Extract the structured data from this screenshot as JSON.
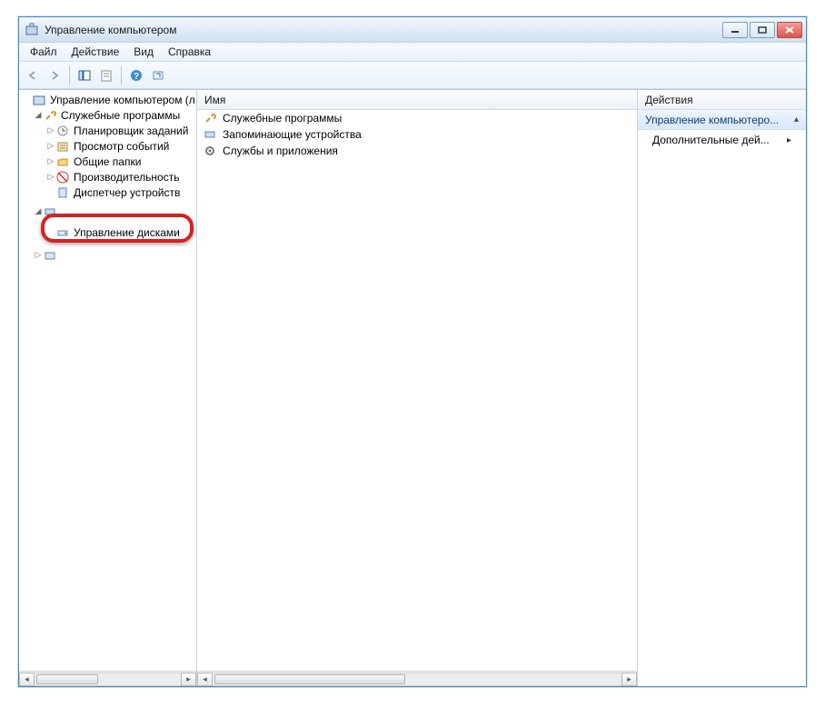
{
  "window": {
    "title": "Управление компьютером"
  },
  "menus": {
    "file": "Файл",
    "action": "Действие",
    "view": "Вид",
    "help": "Справка"
  },
  "tree": {
    "root": "Управление компьютером (л",
    "group_utilities": "Служебные программы",
    "task_scheduler": "Планировщик заданий",
    "event_viewer": "Просмотр событий",
    "shared_folders": "Общие папки",
    "performance": "Производительность",
    "device_manager": "Диспетчер устройств",
    "disk_management": "Управление дисками"
  },
  "list": {
    "header": "Имя",
    "item_utilities": "Служебные программы",
    "item_storage": "Запоминающие устройства",
    "item_services": "Службы и приложения"
  },
  "actions": {
    "header": "Действия",
    "row1": "Управление компьютеро...",
    "row2": "Дополнительные дей..."
  }
}
